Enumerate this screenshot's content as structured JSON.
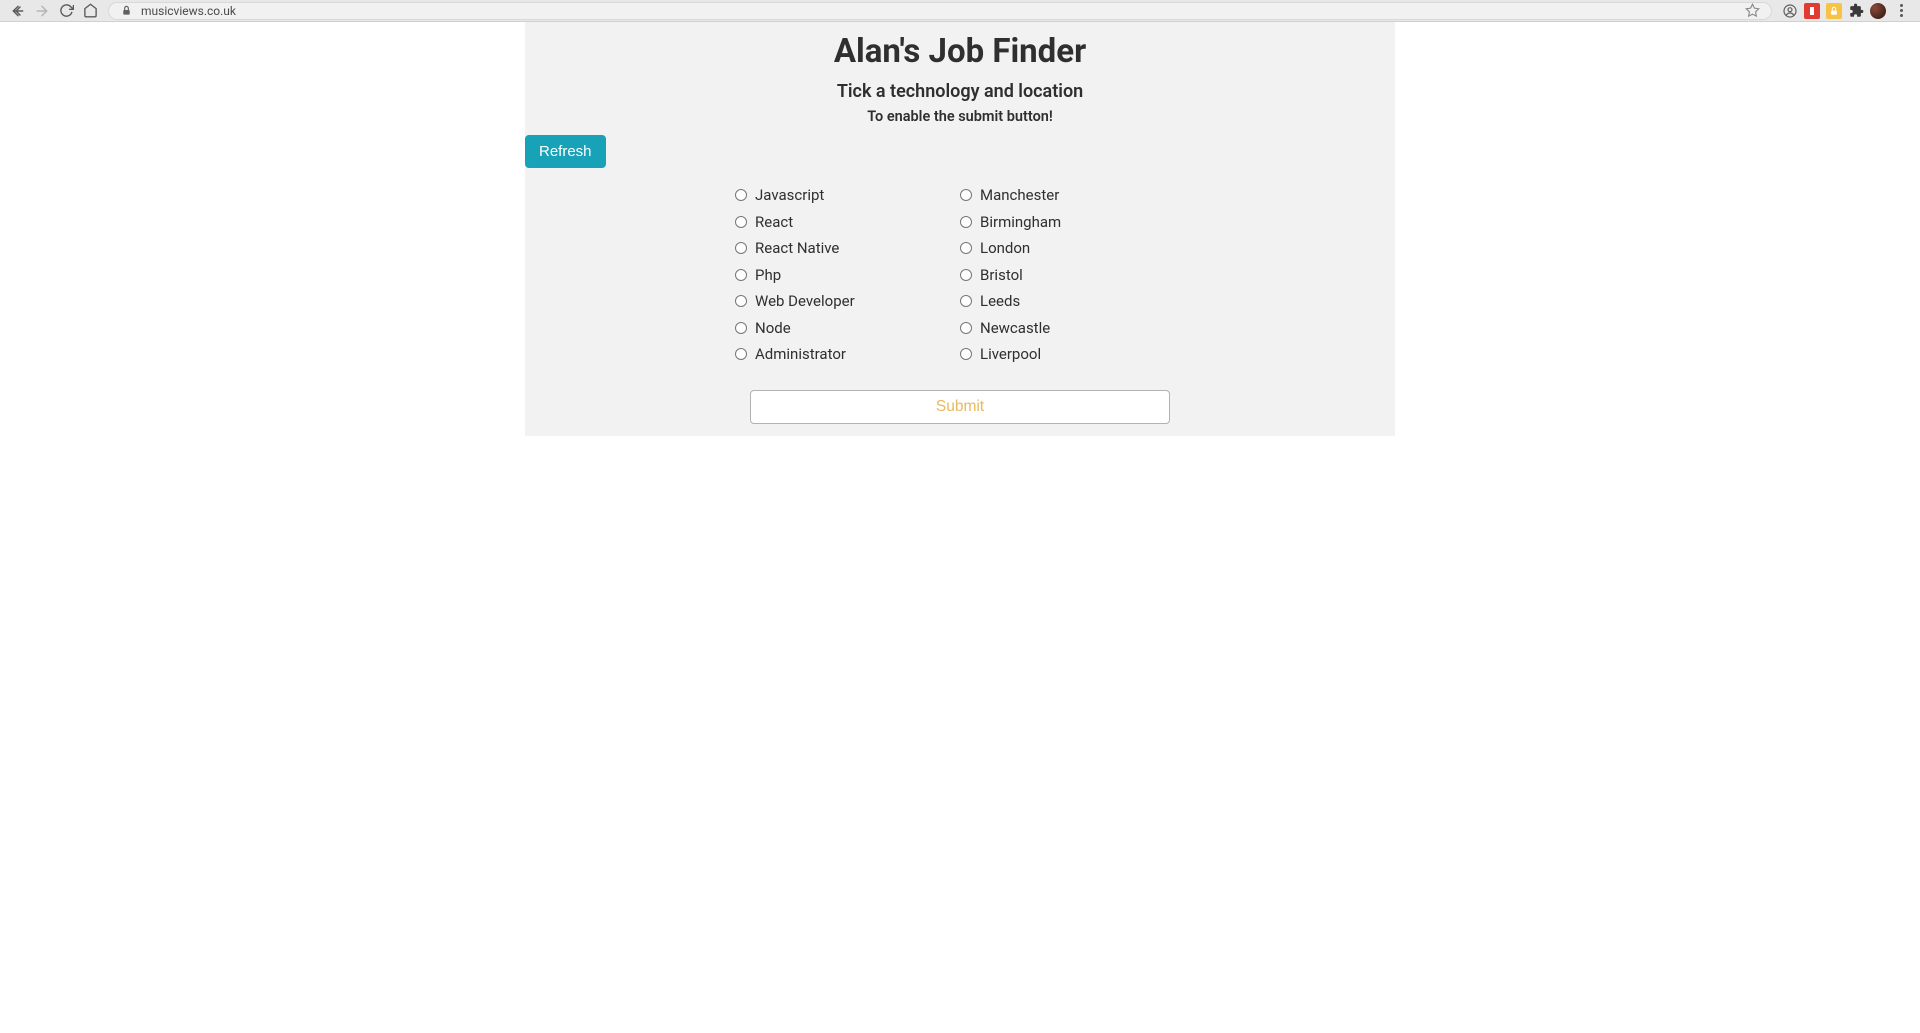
{
  "browser": {
    "url": "musicviews.co.uk"
  },
  "page": {
    "title": "Alan's Job Finder",
    "subtitle": "Tick a technology and location",
    "sub_subtitle": "To enable the submit button!",
    "refresh_label": "Refresh",
    "submit_label": "Submit",
    "technologies": [
      "Javascript",
      "React",
      "React Native",
      "Php",
      "Web Developer",
      "Node",
      "Administrator"
    ],
    "locations": [
      "Manchester",
      "Birmingham",
      "London",
      "Bristol",
      "Leeds",
      "Newcastle",
      "Liverpool"
    ]
  }
}
